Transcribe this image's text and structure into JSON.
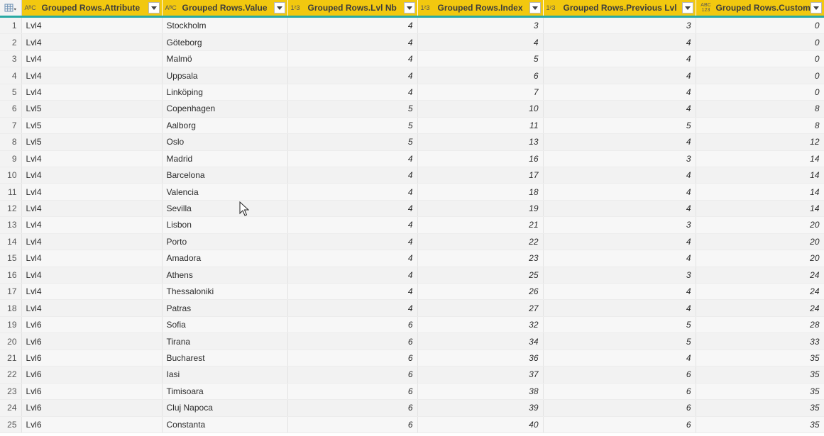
{
  "columns": [
    {
      "type_icon": "ABC",
      "label": "Grouped Rows.Attribute"
    },
    {
      "type_icon": "ABC",
      "label": "Grouped Rows.Value"
    },
    {
      "type_icon": "123",
      "label": "Grouped Rows.Lvl Nb"
    },
    {
      "type_icon": "123",
      "label": "Grouped Rows.Index"
    },
    {
      "type_icon": "123",
      "label": "Grouped Rows.Previous Lvl"
    },
    {
      "type_icon": "ABC123",
      "label": "Grouped Rows.Custom"
    }
  ],
  "type_icons": {
    "ABC": "AᴮC",
    "123": "1²3",
    "ABC123": "ABC\n123"
  },
  "rows": [
    {
      "n": "1",
      "attr": "Lvl4",
      "value": "Stockholm",
      "lvl": "4",
      "index": "3",
      "prev": "3",
      "custom": "0"
    },
    {
      "n": "2",
      "attr": "Lvl4",
      "value": "Göteborg",
      "lvl": "4",
      "index": "4",
      "prev": "4",
      "custom": "0"
    },
    {
      "n": "3",
      "attr": "Lvl4",
      "value": "Malmö",
      "lvl": "4",
      "index": "5",
      "prev": "4",
      "custom": "0"
    },
    {
      "n": "4",
      "attr": "Lvl4",
      "value": "Uppsala",
      "lvl": "4",
      "index": "6",
      "prev": "4",
      "custom": "0"
    },
    {
      "n": "5",
      "attr": "Lvl4",
      "value": "Linköping",
      "lvl": "4",
      "index": "7",
      "prev": "4",
      "custom": "0"
    },
    {
      "n": "6",
      "attr": "Lvl5",
      "value": "Copenhagen",
      "lvl": "5",
      "index": "10",
      "prev": "4",
      "custom": "8"
    },
    {
      "n": "7",
      "attr": "Lvl5",
      "value": "Aalborg",
      "lvl": "5",
      "index": "11",
      "prev": "5",
      "custom": "8"
    },
    {
      "n": "8",
      "attr": "Lvl5",
      "value": "Oslo",
      "lvl": "5",
      "index": "13",
      "prev": "4",
      "custom": "12"
    },
    {
      "n": "9",
      "attr": "Lvl4",
      "value": "Madrid",
      "lvl": "4",
      "index": "16",
      "prev": "3",
      "custom": "14"
    },
    {
      "n": "10",
      "attr": "Lvl4",
      "value": "Barcelona",
      "lvl": "4",
      "index": "17",
      "prev": "4",
      "custom": "14"
    },
    {
      "n": "11",
      "attr": "Lvl4",
      "value": "Valencia",
      "lvl": "4",
      "index": "18",
      "prev": "4",
      "custom": "14"
    },
    {
      "n": "12",
      "attr": "Lvl4",
      "value": "Sevilla",
      "lvl": "4",
      "index": "19",
      "prev": "4",
      "custom": "14"
    },
    {
      "n": "13",
      "attr": "Lvl4",
      "value": "Lisbon",
      "lvl": "4",
      "index": "21",
      "prev": "3",
      "custom": "20"
    },
    {
      "n": "14",
      "attr": "Lvl4",
      "value": "Porto",
      "lvl": "4",
      "index": "22",
      "prev": "4",
      "custom": "20"
    },
    {
      "n": "15",
      "attr": "Lvl4",
      "value": "Amadora",
      "lvl": "4",
      "index": "23",
      "prev": "4",
      "custom": "20"
    },
    {
      "n": "16",
      "attr": "Lvl4",
      "value": "Athens",
      "lvl": "4",
      "index": "25",
      "prev": "3",
      "custom": "24"
    },
    {
      "n": "17",
      "attr": "Lvl4",
      "value": "Thessaloniki",
      "lvl": "4",
      "index": "26",
      "prev": "4",
      "custom": "24"
    },
    {
      "n": "18",
      "attr": "Lvl4",
      "value": "Patras",
      "lvl": "4",
      "index": "27",
      "prev": "4",
      "custom": "24"
    },
    {
      "n": "19",
      "attr": "Lvl6",
      "value": "Sofia",
      "lvl": "6",
      "index": "32",
      "prev": "5",
      "custom": "28"
    },
    {
      "n": "20",
      "attr": "Lvl6",
      "value": "Tirana",
      "lvl": "6",
      "index": "34",
      "prev": "5",
      "custom": "33"
    },
    {
      "n": "21",
      "attr": "Lvl6",
      "value": "Bucharest",
      "lvl": "6",
      "index": "36",
      "prev": "4",
      "custom": "35"
    },
    {
      "n": "22",
      "attr": "Lvl6",
      "value": "Iasi",
      "lvl": "6",
      "index": "37",
      "prev": "6",
      "custom": "35"
    },
    {
      "n": "23",
      "attr": "Lvl6",
      "value": "Timisoara",
      "lvl": "6",
      "index": "38",
      "prev": "6",
      "custom": "35"
    },
    {
      "n": "24",
      "attr": "Lvl6",
      "value": "Cluj Napoca",
      "lvl": "6",
      "index": "39",
      "prev": "6",
      "custom": "35"
    },
    {
      "n": "25",
      "attr": "Lvl6",
      "value": "Constanta",
      "lvl": "6",
      "index": "40",
      "prev": "6",
      "custom": "35"
    }
  ],
  "colors": {
    "header_bg": "#f2c80f",
    "header_underline": "#28a9a3"
  }
}
